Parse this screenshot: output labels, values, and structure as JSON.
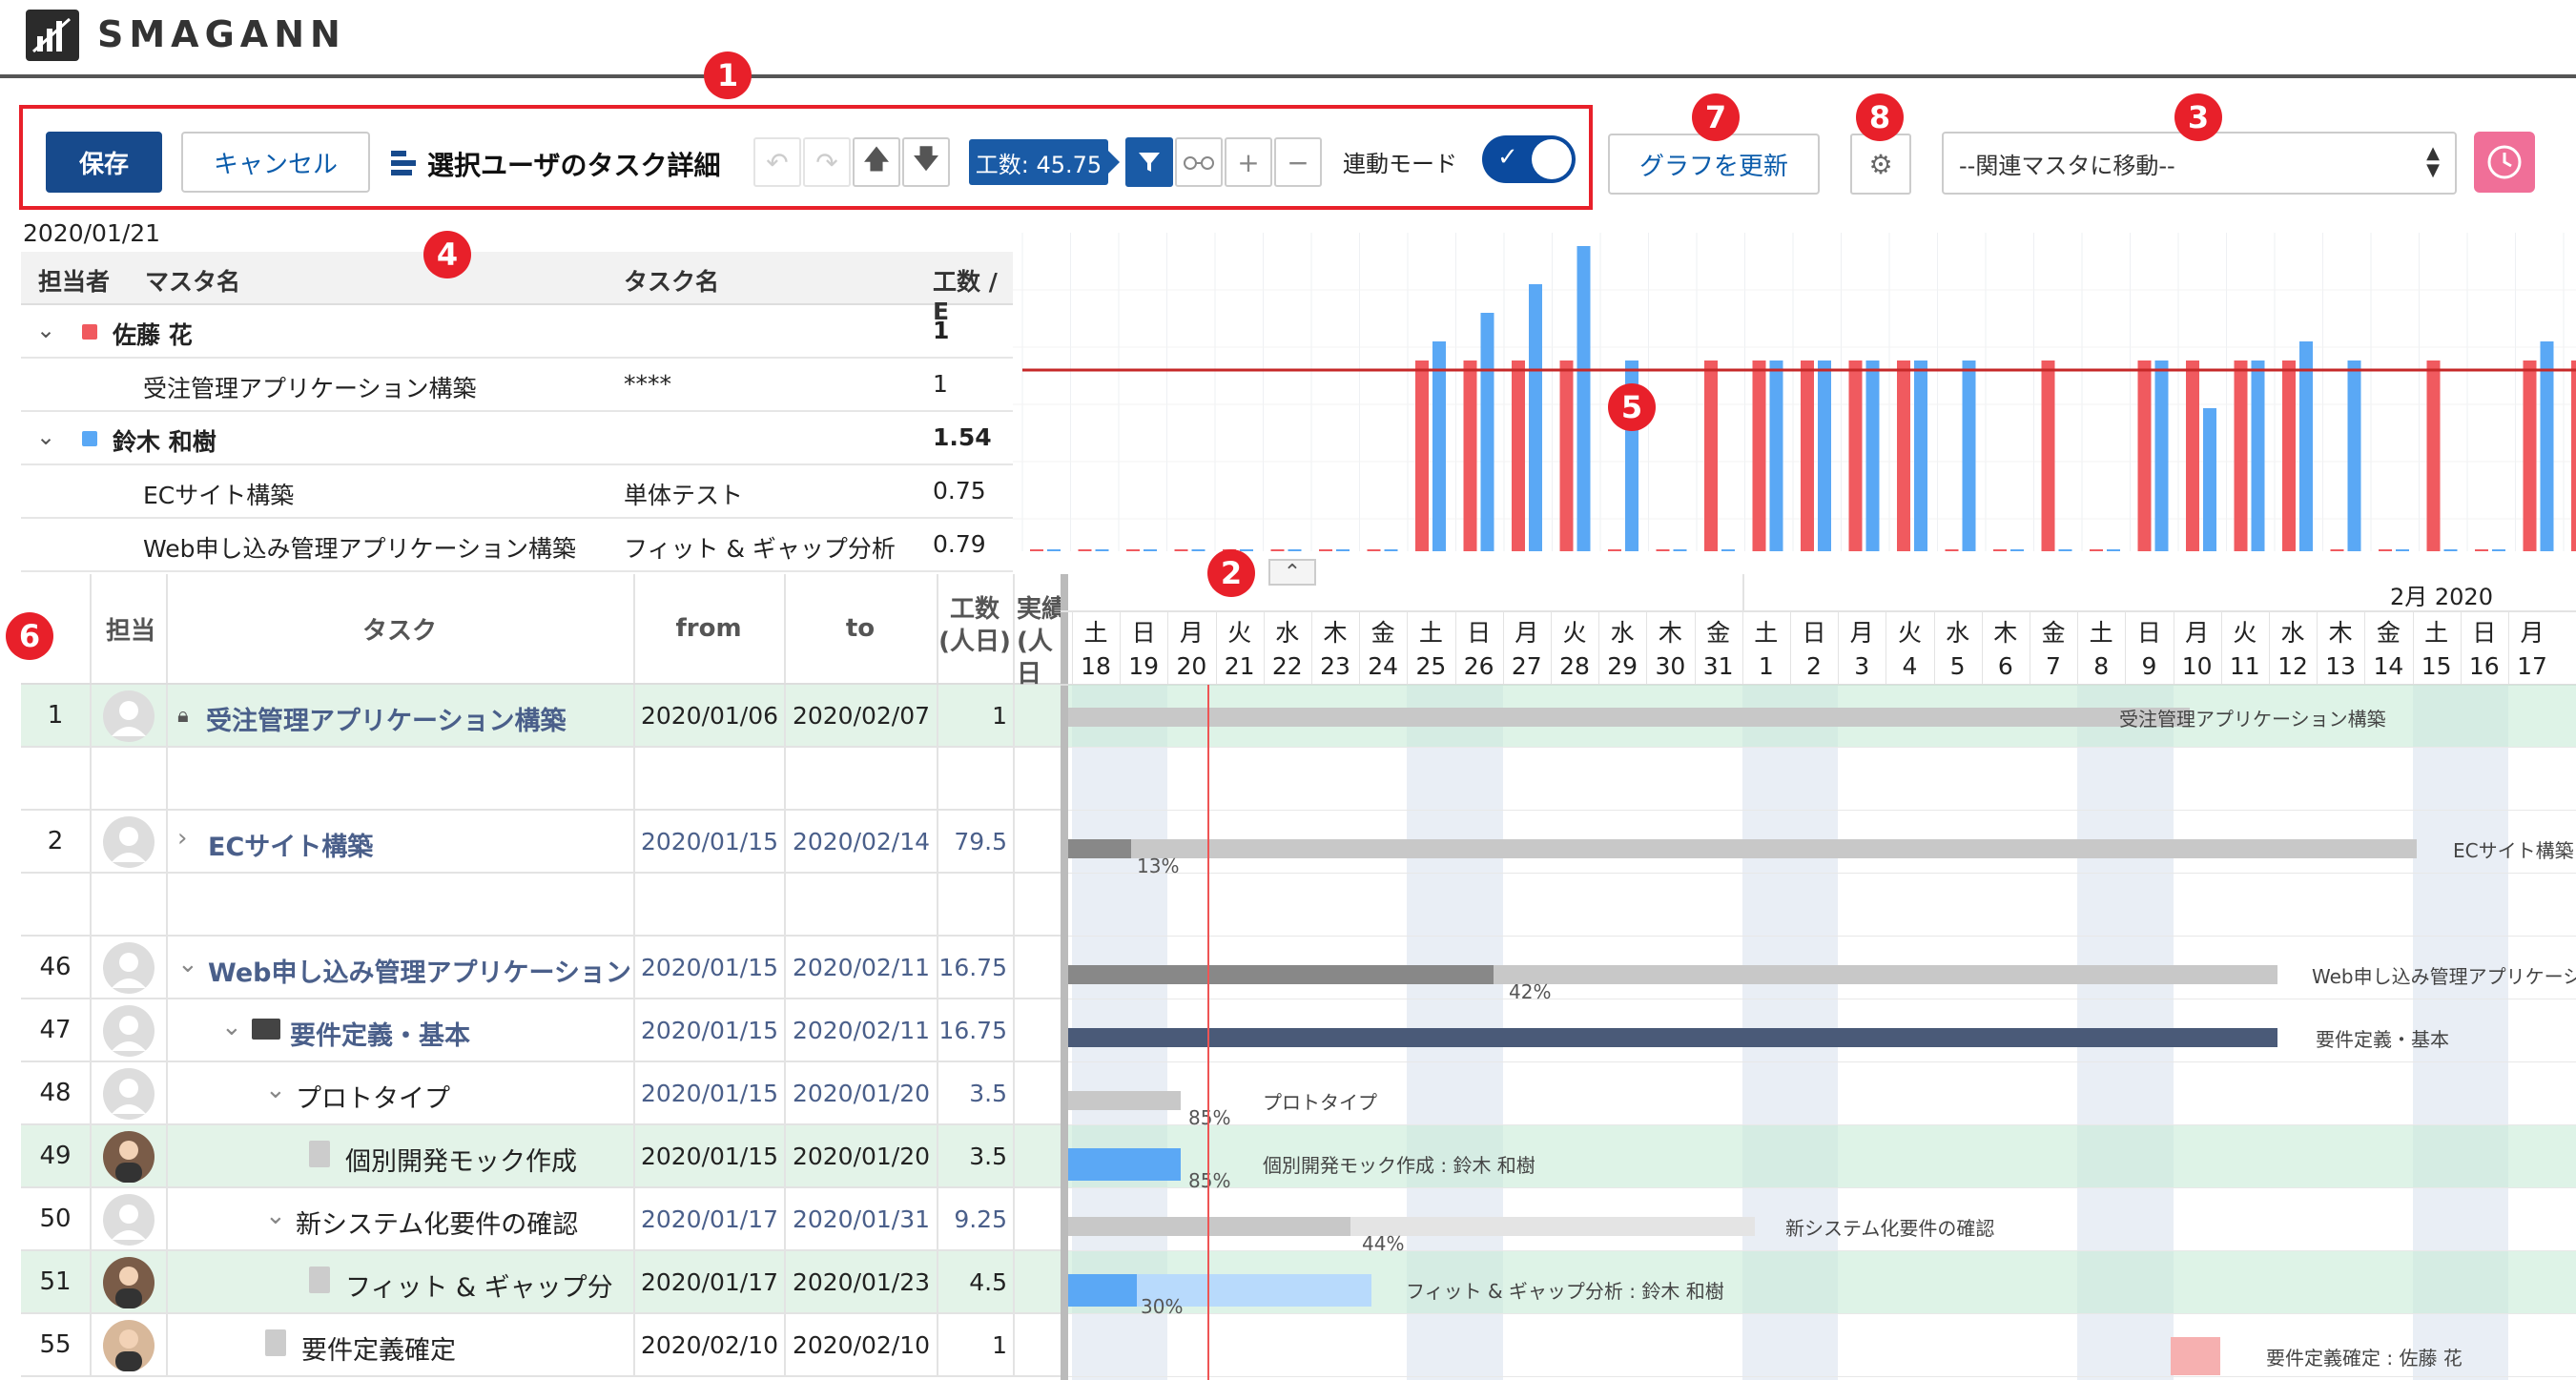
{
  "app": {
    "logo_text": "SMAGANN"
  },
  "toolbar": {
    "save_label": "保存",
    "cancel_label": "キャンセル",
    "title": "選択ユーザのタスク詳細",
    "workload_label": "工数: 45.75",
    "link_mode_label": "連動モード",
    "link_mode_on": true,
    "update_graph_label": "グラフを更新",
    "related_master_placeholder": "--関連マスタに移動--"
  },
  "badges": [
    "1",
    "2",
    "3",
    "4",
    "5",
    "6",
    "7",
    "8"
  ],
  "summary": {
    "date": "2020/01/21",
    "columns": [
      "担当者",
      "マスタ名",
      "タスク名",
      "工数 / E"
    ],
    "rows": [
      {
        "assignee": "佐藤 花",
        "master": "",
        "task": "",
        "value": "1",
        "group": true,
        "color": "#f05a5f"
      },
      {
        "assignee": "",
        "master": "受注管理アプリケーション構築",
        "task": "****",
        "value": "1",
        "group": false
      },
      {
        "assignee": "鈴木 和樹",
        "master": "",
        "task": "",
        "value": "1.54",
        "group": true,
        "color": "#5aa8f5"
      },
      {
        "assignee": "",
        "master": "ECサイト構築",
        "task": "単体テスト",
        "value": "0.75",
        "group": false
      },
      {
        "assignee": "",
        "master": "Web申し込み管理アプリケーション構築",
        "task": "フィット & ギャップ分析",
        "value": "0.79",
        "group": false
      }
    ]
  },
  "chart_data": {
    "type": "bar",
    "series": [
      {
        "name": "佐藤 花",
        "values": [
          0,
          0,
          0,
          0,
          0,
          0,
          0,
          0,
          1,
          1,
          1,
          1,
          0,
          0,
          1,
          1,
          1,
          1,
          1,
          0,
          0,
          1,
          0,
          1,
          1,
          1,
          1,
          0,
          0,
          1,
          0,
          1,
          1,
          1,
          1,
          0,
          0,
          1,
          1,
          1,
          0,
          0
        ],
        "color": "#f05a5f"
      },
      {
        "name": "鈴木 和樹",
        "values": [
          0,
          0,
          0,
          0,
          0,
          0,
          0,
          0,
          1.1,
          1.25,
          1.4,
          1.6,
          1,
          0,
          0,
          1,
          1,
          1,
          1,
          1,
          0,
          0,
          0,
          1,
          0.75,
          1,
          1.1,
          1.0,
          0,
          0,
          0,
          1.1,
          0.9,
          1,
          0.8,
          0,
          0,
          0,
          1,
          0,
          0,
          0
        ],
        "color": "#5aa8f5"
      }
    ],
    "threshold": 1,
    "threshold_color": "#c62828"
  },
  "tasks": {
    "headers": {
      "assignee": "担当",
      "task": "タスク",
      "from": "from",
      "to": "to",
      "work": "工数",
      "work_unit": "(人日)",
      "actual": "実績",
      "actual_unit": "(人日"
    },
    "rows": [
      {
        "no": "1",
        "task": "受注管理アプリケーション構築",
        "from": "2020/01/06",
        "to": "2020/02/07",
        "work": "1",
        "bold": true,
        "lock": true,
        "indent": 0,
        "highlight": true
      },
      {
        "no": "2",
        "task": "ECサイト構築",
        "from": "2020/01/15",
        "to": "2020/02/14",
        "work": "79.5",
        "bold": true,
        "expander": "›",
        "indent": 0,
        "highlight": false
      },
      {
        "no": "46",
        "task": "Web申し込み管理アプリケーション",
        "from": "2020/01/15",
        "to": "2020/02/11",
        "work": "16.75",
        "bold": true,
        "expander": "⌄",
        "indent": 0,
        "highlight": false
      },
      {
        "no": "47",
        "task": "要件定義・基本",
        "from": "2020/01/15",
        "to": "2020/02/11",
        "work": "16.75",
        "bold": true,
        "expander": "⌄",
        "folder": true,
        "indent": 1,
        "highlight": false
      },
      {
        "no": "48",
        "task": "プロトタイプ",
        "from": "2020/01/15",
        "to": "2020/01/20",
        "work": "3.5",
        "bold": false,
        "expander": "⌄",
        "indent": 2,
        "highlight": false
      },
      {
        "no": "49",
        "task": "個別開発モック作成",
        "from": "2020/01/15",
        "to": "2020/01/20",
        "work": "3.5",
        "bold": false,
        "doc": true,
        "indent": 3,
        "highlight": true,
        "person": true
      },
      {
        "no": "50",
        "task": "新システム化要件の確認",
        "from": "2020/01/17",
        "to": "2020/01/31",
        "work": "9.25",
        "bold": false,
        "expander": "⌄",
        "indent": 2,
        "highlight": false
      },
      {
        "no": "51",
        "task": "フィット & ギャップ分",
        "from": "2020/01/17",
        "to": "2020/01/23",
        "work": "4.5",
        "bold": false,
        "doc": true,
        "indent": 3,
        "highlight": true,
        "person": true
      },
      {
        "no": "55",
        "task": "要件定義確定",
        "from": "2020/02/10",
        "to": "2020/02/10",
        "work": "1",
        "bold": false,
        "doc": true,
        "indent": 2,
        "highlight": false,
        "person_female": true
      }
    ]
  },
  "gantt": {
    "month_label": "2月 2020",
    "weekdays": [
      "土",
      "日",
      "月",
      "火",
      "水",
      "木",
      "金",
      "土",
      "日",
      "月",
      "火",
      "水",
      "木",
      "金",
      "土",
      "日",
      "月",
      "火",
      "水",
      "木",
      "金",
      "土",
      "日",
      "月",
      "火",
      "水",
      "木",
      "金",
      "土",
      "日",
      "月"
    ],
    "days": [
      "18",
      "19",
      "20",
      "21",
      "22",
      "23",
      "24",
      "25",
      "26",
      "27",
      "28",
      "29",
      "30",
      "31",
      "1",
      "2",
      "3",
      "4",
      "5",
      "6",
      "7",
      "8",
      "9",
      "10",
      "11",
      "12",
      "13",
      "14",
      "15",
      "16",
      "17"
    ],
    "bar_labels": [
      "受注管理アプリケーション構築",
      "ECサイト構築",
      "Web申し込み管理アプリケーシ",
      "要件定義・基本",
      "プロトタイプ",
      "個別開発モック作成 : 鈴木 和樹",
      "新システム化要件の確認",
      "フィット & ギャップ分析 : 鈴木 和樹",
      "要件定義確定 : 佐藤 花"
    ],
    "percents": [
      "13%",
      "42%",
      "85%",
      "85%",
      "44%",
      "30%"
    ]
  }
}
